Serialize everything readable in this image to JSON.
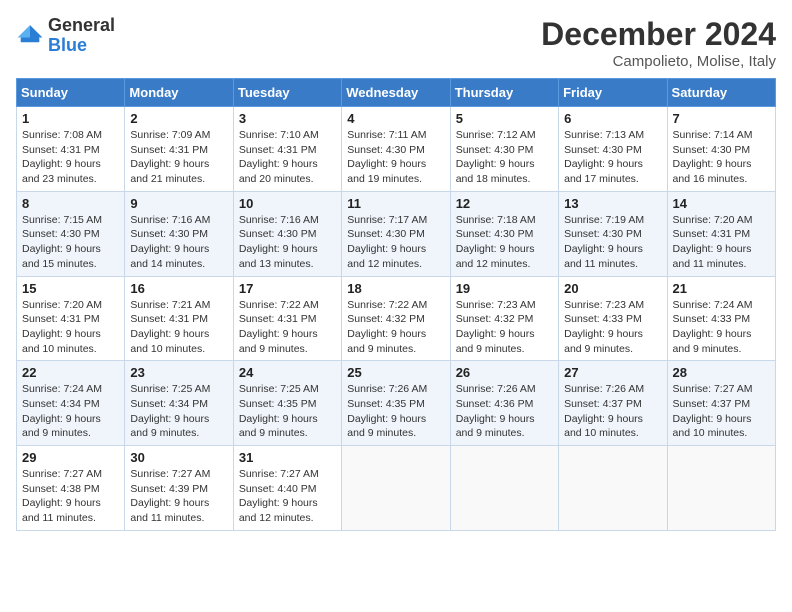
{
  "logo": {
    "general": "General",
    "blue": "Blue"
  },
  "header": {
    "month": "December 2024",
    "location": "Campolieto, Molise, Italy"
  },
  "weekdays": [
    "Sunday",
    "Monday",
    "Tuesday",
    "Wednesday",
    "Thursday",
    "Friday",
    "Saturday"
  ],
  "weeks": [
    [
      {
        "day": "1",
        "sunrise": "7:08 AM",
        "sunset": "4:31 PM",
        "daylight": "9 hours and 23 minutes."
      },
      {
        "day": "2",
        "sunrise": "7:09 AM",
        "sunset": "4:31 PM",
        "daylight": "9 hours and 21 minutes."
      },
      {
        "day": "3",
        "sunrise": "7:10 AM",
        "sunset": "4:31 PM",
        "daylight": "9 hours and 20 minutes."
      },
      {
        "day": "4",
        "sunrise": "7:11 AM",
        "sunset": "4:30 PM",
        "daylight": "9 hours and 19 minutes."
      },
      {
        "day": "5",
        "sunrise": "7:12 AM",
        "sunset": "4:30 PM",
        "daylight": "9 hours and 18 minutes."
      },
      {
        "day": "6",
        "sunrise": "7:13 AM",
        "sunset": "4:30 PM",
        "daylight": "9 hours and 17 minutes."
      },
      {
        "day": "7",
        "sunrise": "7:14 AM",
        "sunset": "4:30 PM",
        "daylight": "9 hours and 16 minutes."
      }
    ],
    [
      {
        "day": "8",
        "sunrise": "7:15 AM",
        "sunset": "4:30 PM",
        "daylight": "9 hours and 15 minutes."
      },
      {
        "day": "9",
        "sunrise": "7:16 AM",
        "sunset": "4:30 PM",
        "daylight": "9 hours and 14 minutes."
      },
      {
        "day": "10",
        "sunrise": "7:16 AM",
        "sunset": "4:30 PM",
        "daylight": "9 hours and 13 minutes."
      },
      {
        "day": "11",
        "sunrise": "7:17 AM",
        "sunset": "4:30 PM",
        "daylight": "9 hours and 12 minutes."
      },
      {
        "day": "12",
        "sunrise": "7:18 AM",
        "sunset": "4:30 PM",
        "daylight": "9 hours and 12 minutes."
      },
      {
        "day": "13",
        "sunrise": "7:19 AM",
        "sunset": "4:30 PM",
        "daylight": "9 hours and 11 minutes."
      },
      {
        "day": "14",
        "sunrise": "7:20 AM",
        "sunset": "4:31 PM",
        "daylight": "9 hours and 11 minutes."
      }
    ],
    [
      {
        "day": "15",
        "sunrise": "7:20 AM",
        "sunset": "4:31 PM",
        "daylight": "9 hours and 10 minutes."
      },
      {
        "day": "16",
        "sunrise": "7:21 AM",
        "sunset": "4:31 PM",
        "daylight": "9 hours and 10 minutes."
      },
      {
        "day": "17",
        "sunrise": "7:22 AM",
        "sunset": "4:31 PM",
        "daylight": "9 hours and 9 minutes."
      },
      {
        "day": "18",
        "sunrise": "7:22 AM",
        "sunset": "4:32 PM",
        "daylight": "9 hours and 9 minutes."
      },
      {
        "day": "19",
        "sunrise": "7:23 AM",
        "sunset": "4:32 PM",
        "daylight": "9 hours and 9 minutes."
      },
      {
        "day": "20",
        "sunrise": "7:23 AM",
        "sunset": "4:33 PM",
        "daylight": "9 hours and 9 minutes."
      },
      {
        "day": "21",
        "sunrise": "7:24 AM",
        "sunset": "4:33 PM",
        "daylight": "9 hours and 9 minutes."
      }
    ],
    [
      {
        "day": "22",
        "sunrise": "7:24 AM",
        "sunset": "4:34 PM",
        "daylight": "9 hours and 9 minutes."
      },
      {
        "day": "23",
        "sunrise": "7:25 AM",
        "sunset": "4:34 PM",
        "daylight": "9 hours and 9 minutes."
      },
      {
        "day": "24",
        "sunrise": "7:25 AM",
        "sunset": "4:35 PM",
        "daylight": "9 hours and 9 minutes."
      },
      {
        "day": "25",
        "sunrise": "7:26 AM",
        "sunset": "4:35 PM",
        "daylight": "9 hours and 9 minutes."
      },
      {
        "day": "26",
        "sunrise": "7:26 AM",
        "sunset": "4:36 PM",
        "daylight": "9 hours and 9 minutes."
      },
      {
        "day": "27",
        "sunrise": "7:26 AM",
        "sunset": "4:37 PM",
        "daylight": "9 hours and 10 minutes."
      },
      {
        "day": "28",
        "sunrise": "7:27 AM",
        "sunset": "4:37 PM",
        "daylight": "9 hours and 10 minutes."
      }
    ],
    [
      {
        "day": "29",
        "sunrise": "7:27 AM",
        "sunset": "4:38 PM",
        "daylight": "9 hours and 11 minutes."
      },
      {
        "day": "30",
        "sunrise": "7:27 AM",
        "sunset": "4:39 PM",
        "daylight": "9 hours and 11 minutes."
      },
      {
        "day": "31",
        "sunrise": "7:27 AM",
        "sunset": "4:40 PM",
        "daylight": "9 hours and 12 minutes."
      },
      null,
      null,
      null,
      null
    ]
  ],
  "labels": {
    "sunrise": "Sunrise:",
    "sunset": "Sunset:",
    "daylight": "Daylight:"
  }
}
